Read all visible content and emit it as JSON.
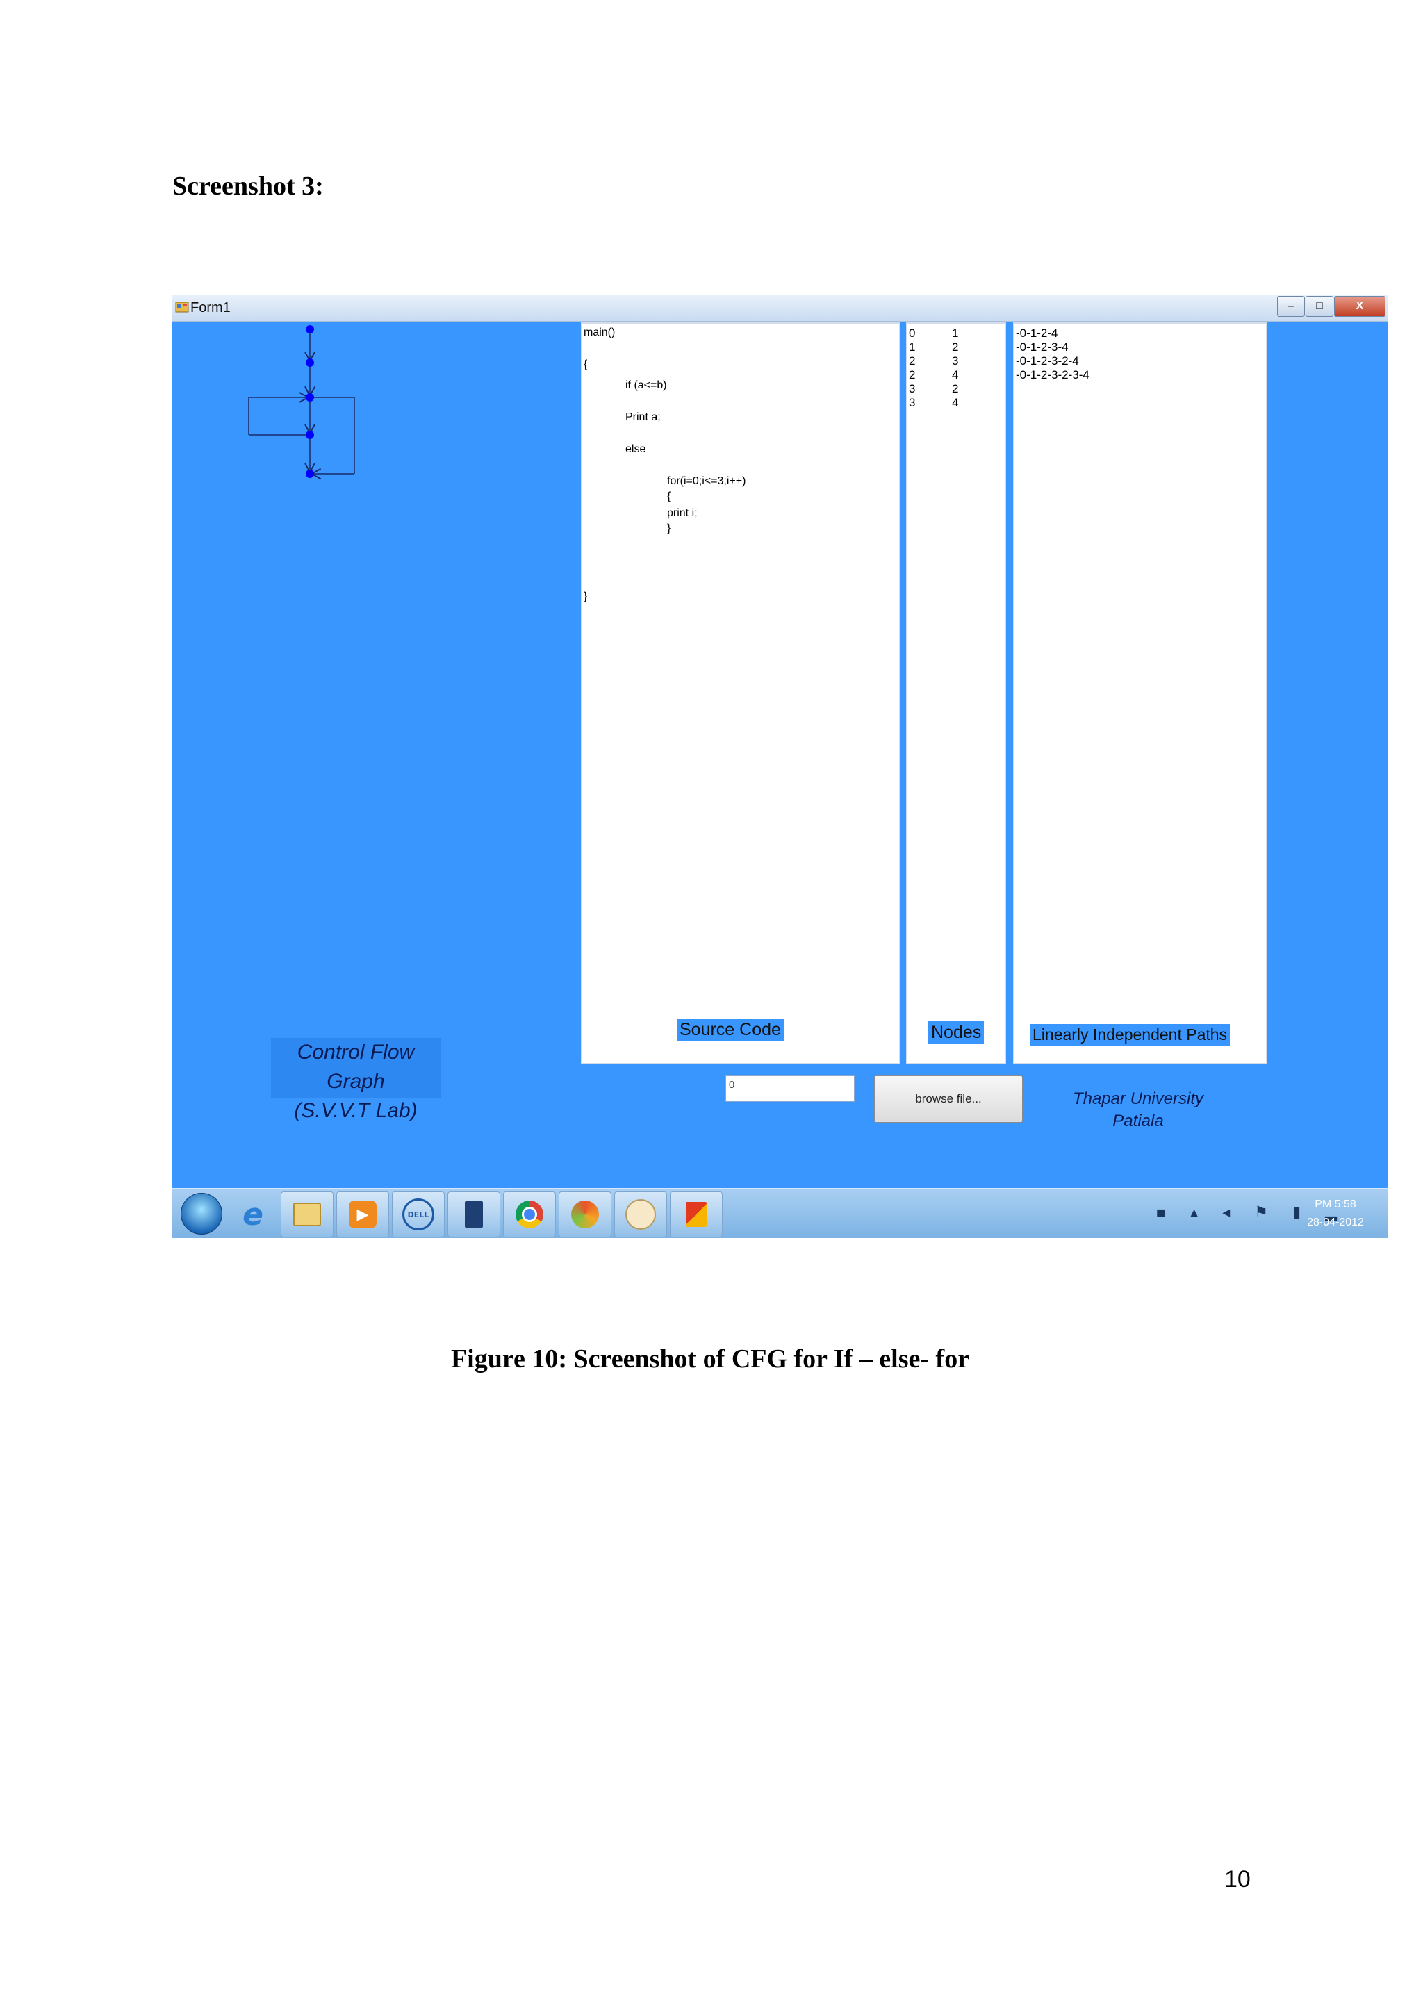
{
  "heading": "Screenshot 3:",
  "caption": "Figure 10: Screenshot of CFG for If – else- for",
  "page_number": "10",
  "window": {
    "title": "Form1",
    "buttons": {
      "minimize": "–",
      "maximize": "□",
      "close": "X"
    }
  },
  "source_code": {
    "label": "Source Code",
    "lines": [
      {
        "text": "main()",
        "indent": 0
      },
      {
        "text": "{",
        "indent": 0
      },
      {
        "text": "if (a<=b)",
        "indent": 1
      },
      {
        "text": "Print a;",
        "indent": 1
      },
      {
        "text": "else",
        "indent": 1
      },
      {
        "text": "for(i=0;i<=3;i++)",
        "indent": 2
      },
      {
        "text": "{",
        "indent": 2
      },
      {
        "text": "print i;",
        "indent": 2
      },
      {
        "text": "}",
        "indent": 2
      },
      {
        "text": "}",
        "indent": 0
      }
    ]
  },
  "nodes": {
    "label": "Nodes",
    "rows": [
      [
        "0",
        "1"
      ],
      [
        "1",
        "2"
      ],
      [
        "2",
        "3"
      ],
      [
        "2",
        "4"
      ],
      [
        "3",
        "2"
      ],
      [
        "3",
        "4"
      ]
    ]
  },
  "paths": {
    "label": "Linearly Independent Paths",
    "items": [
      "-0-1-2-4",
      "-0-1-2-3-4",
      "-0-1-2-3-2-4",
      "-0-1-2-3-2-3-4"
    ]
  },
  "cfg_title": {
    "line1": "Control Flow Graph",
    "line2": "(S.V.V.T Lab)"
  },
  "file_input": {
    "value": "0"
  },
  "browse_button": "browse file...",
  "university": {
    "line1": "Thapar University",
    "line2": "Patiala"
  },
  "taskbar": {
    "items": [
      "start-orb",
      "internet-explorer-icon",
      "file-explorer-icon",
      "media-player-icon",
      "dell-icon",
      "app-window-icon",
      "chrome-icon",
      "visual-studio-icon",
      "paint-icon",
      "office-icon"
    ],
    "time": "PM 5:58",
    "date": "28-04-2012"
  },
  "colors": {
    "window_bg": "#3896fe",
    "node": "#0000ff"
  }
}
